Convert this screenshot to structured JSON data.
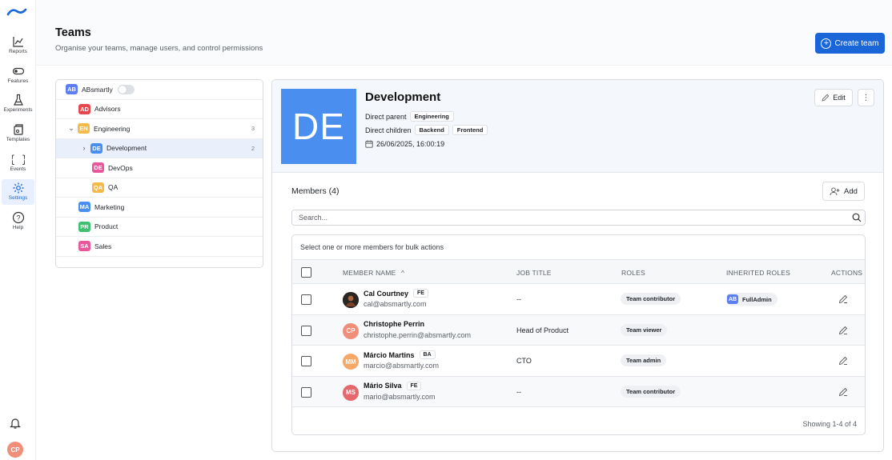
{
  "sidebar": {
    "items": [
      {
        "label": "Reports",
        "icon": "chart-icon"
      },
      {
        "label": "Features",
        "icon": "toggle-icon"
      },
      {
        "label": "Experiments",
        "icon": "flask-icon"
      },
      {
        "label": "Templates",
        "icon": "template-icon"
      },
      {
        "label": "Events",
        "icon": "braces-icon"
      },
      {
        "label": "Settings",
        "icon": "gear-icon",
        "active": true
      },
      {
        "label": "Help",
        "icon": "help-icon"
      }
    ],
    "user_initials": "CP"
  },
  "header": {
    "title": "Teams",
    "subtitle": "Organise your teams, manage users, and control permissions",
    "create_label": "Create team"
  },
  "tree": {
    "rows": [
      {
        "badge": "AB",
        "label": "ABsmartly",
        "color": "#5b7ff0"
      },
      {
        "badge": "AD",
        "label": "Advisors",
        "color": "#e5484d"
      },
      {
        "badge": "EN",
        "label": "Engineering",
        "color": "#f5b84a",
        "count": "3"
      },
      {
        "badge": "DE",
        "label": "Development",
        "color": "#4a8fef",
        "count": "2"
      },
      {
        "badge": "DE",
        "label": "DevOps",
        "color": "#e8579c"
      },
      {
        "badge": "QA",
        "label": "QA",
        "color": "#f5b84a"
      },
      {
        "badge": "MA",
        "label": "Marketing",
        "color": "#4a8fef"
      },
      {
        "badge": "PR",
        "label": "Product",
        "color": "#3fbf6f"
      },
      {
        "badge": "SA",
        "label": "Sales",
        "color": "#e8579c"
      }
    ]
  },
  "team": {
    "initials": "DE",
    "name": "Development",
    "parent_label": "Direct parent",
    "parent": "Engineering",
    "children_label": "Direct children",
    "children": [
      "Backend",
      "Frontend"
    ],
    "date": "26/06/2025, 16:00:19",
    "edit_label": "Edit"
  },
  "members": {
    "title": "Members (4)",
    "add_label": "Add",
    "search_placeholder": "Search...",
    "bulk_text": "Select one or more members for bulk actions",
    "columns": {
      "name": "MEMBER NAME",
      "job": "JOB TITLE",
      "roles": "ROLES",
      "inherited": "INHERITED ROLES",
      "actions": "ACTIONS"
    },
    "sort_glyph": "^",
    "rows": [
      {
        "name": "Cal Courtney",
        "tag": "FE",
        "email": "cal@absmartly.com",
        "job": "--",
        "role": "Team contributor",
        "inherited_badge": "AB",
        "inherited": "FullAdmin",
        "avatar": "",
        "avatar_color": "#2a2520"
      },
      {
        "name": "Christophe Perrin",
        "tag": "",
        "email": "christophe.perrin@absmartly.com",
        "job": "Head of Product",
        "role": "Team viewer",
        "inherited_badge": "",
        "inherited": "",
        "avatar": "CP",
        "avatar_color": "#f08e7a"
      },
      {
        "name": "Márcio Martins",
        "tag": "BA",
        "email": "marcio@absmartly.com",
        "job": "CTO",
        "role": "Team admin",
        "inherited_badge": "",
        "inherited": "",
        "avatar": "MM",
        "avatar_color": "#f5a86a"
      },
      {
        "name": "Mário Silva",
        "tag": "FE",
        "email": "mario@absmartly.com",
        "job": "--",
        "role": "Team contributor",
        "inherited_badge": "",
        "inherited": "",
        "avatar": "MS",
        "avatar_color": "#e5686d"
      }
    ],
    "footer": "Showing 1-4 of 4"
  }
}
